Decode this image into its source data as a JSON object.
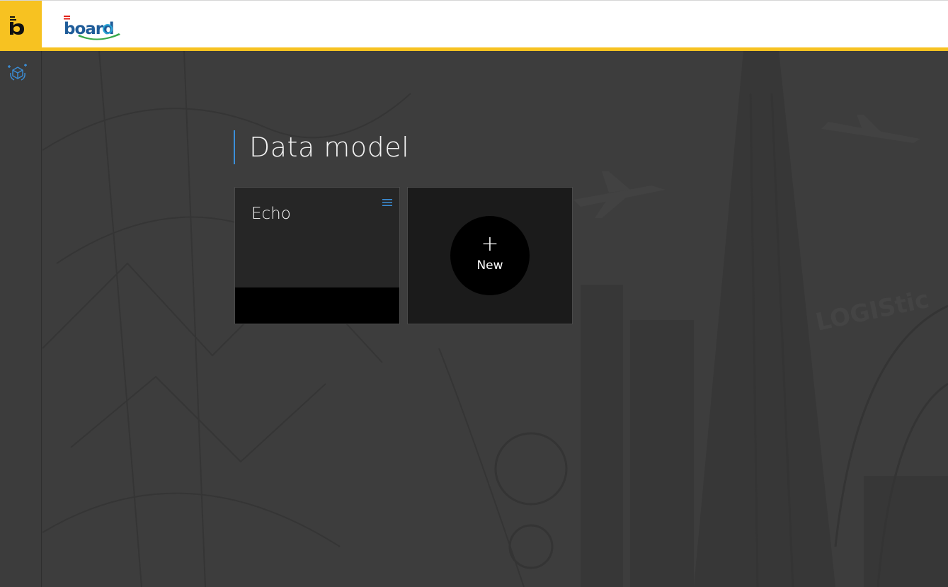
{
  "header": {
    "app_icon": "board-b-icon",
    "logo_text": "board",
    "accent_color": "#f7c221"
  },
  "sidebar": {
    "items": [
      {
        "icon": "data-model-cube-icon"
      }
    ]
  },
  "main": {
    "title": "Data model",
    "title_accent": "#3b8fd9",
    "tiles": [
      {
        "name": "Echo",
        "menu_icon": "hamburger-menu-icon"
      }
    ],
    "new_tile": {
      "symbol": "+",
      "label": "New"
    }
  }
}
